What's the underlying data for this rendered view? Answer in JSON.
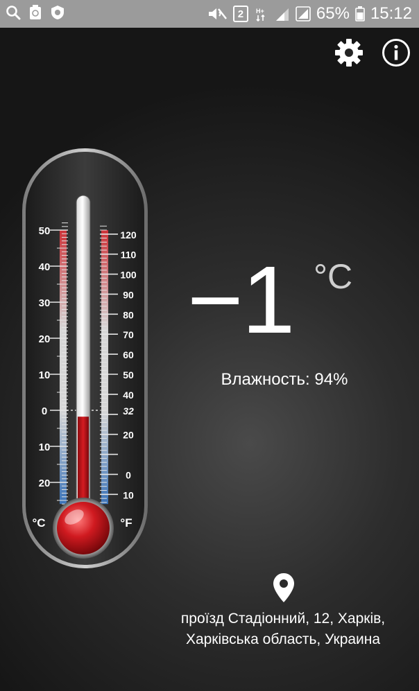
{
  "status_bar": {
    "battery_percent": "65%",
    "time": "15:12",
    "sim_badge": "2",
    "icons": [
      "search-icon",
      "recycle-icon",
      "shield-icon",
      "mute-icon",
      "network-icon",
      "signal-icon",
      "signal-icon",
      "battery-icon"
    ]
  },
  "toolbar": {
    "settings_icon": "gear-icon",
    "info_icon": "info-icon"
  },
  "thermometer": {
    "celsius_labels": [
      "50",
      "40",
      "30",
      "20",
      "10",
      "0",
      "10",
      "20"
    ],
    "fahrenheit_labels": [
      "120",
      "110",
      "100",
      "90",
      "80",
      "70",
      "60",
      "50",
      "40",
      "32",
      "20",
      "0",
      "10"
    ],
    "celsius_unit": "°C",
    "fahrenheit_unit": "°F",
    "celsius_values": [
      50,
      40,
      30,
      20,
      10,
      0,
      -10,
      -20
    ],
    "fahrenheit_values": [
      120,
      110,
      100,
      90,
      80,
      70,
      60,
      50,
      40,
      32,
      20,
      0,
      -10
    ],
    "current_celsius": -1,
    "colors": {
      "mercury": "#c8151c",
      "hot_scale": "#d9343a",
      "cold_scale": "#4a7fc4"
    }
  },
  "reading": {
    "temperature": "−1",
    "unit": "°C",
    "humidity": "Влажность: 94%"
  },
  "location": {
    "icon": "location-pin-icon",
    "line1": "проїзд Стадіонний, 12, Харків,",
    "line2": "Харківська область, Украина"
  }
}
